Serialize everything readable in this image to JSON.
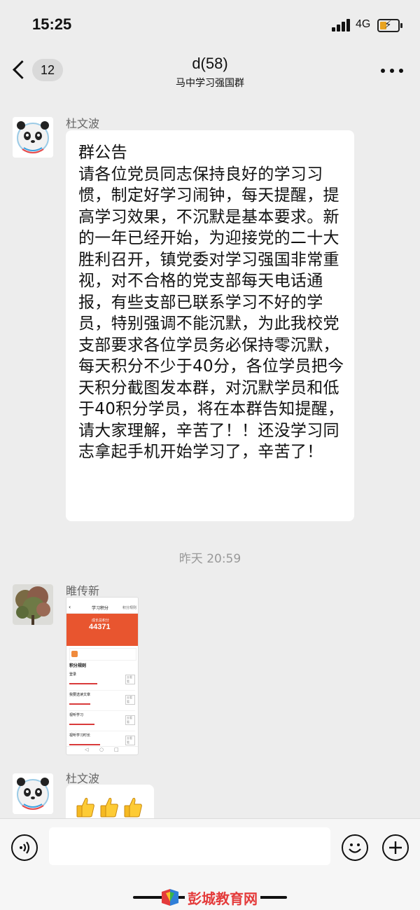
{
  "status": {
    "time": "15:25",
    "network": "4G"
  },
  "nav": {
    "back_count": "12",
    "title": "d(58)",
    "subtitle": "马中学习强国群"
  },
  "messages": [
    {
      "sender": "杜文波",
      "text": "群公告\n请各位党员同志保持良好的学习习惯，制定好学习闹钟，每天提醒，提高学习效果，不沉默是基本要求。新的一年已经开始，为迎接党的二十大胜利召开，镇党委对学习强国非常重视，对不合格的党支部每天电话通报，有些支部已联系学习不好的学员，特别强调不能沉默，为此我校党支部要求各位学员务必保持零沉默，每天积分不少于40分，各位学员把今天积分截图发本群，对沉默学员和低于40积分学员，将在本群告知提醒，请大家理解，辛苦了！！还没学习同志拿起手机开始学习了，辛苦了！"
    },
    {
      "timestamp": "昨天 20:59"
    },
    {
      "sender": "睢传新",
      "screenshot": {
        "header": "学习积分",
        "header_right": "积分规则",
        "total_label": "成长总积分",
        "total_points": "44371",
        "section": "积分规则",
        "items": [
          "登录",
          "我要选读文章",
          "视听学习",
          "视听学习时长"
        ],
        "action": "去看看"
      }
    },
    {
      "sender": "杜文波",
      "emoji": [
        "thumbs-up",
        "thumbs-up",
        "thumbs-up"
      ]
    }
  ],
  "watermark": "彭城教育网",
  "colors": {
    "background": "#ededed",
    "bubble": "#ffffff",
    "timestamp": "#999999",
    "shot_header": "#e8552f"
  }
}
